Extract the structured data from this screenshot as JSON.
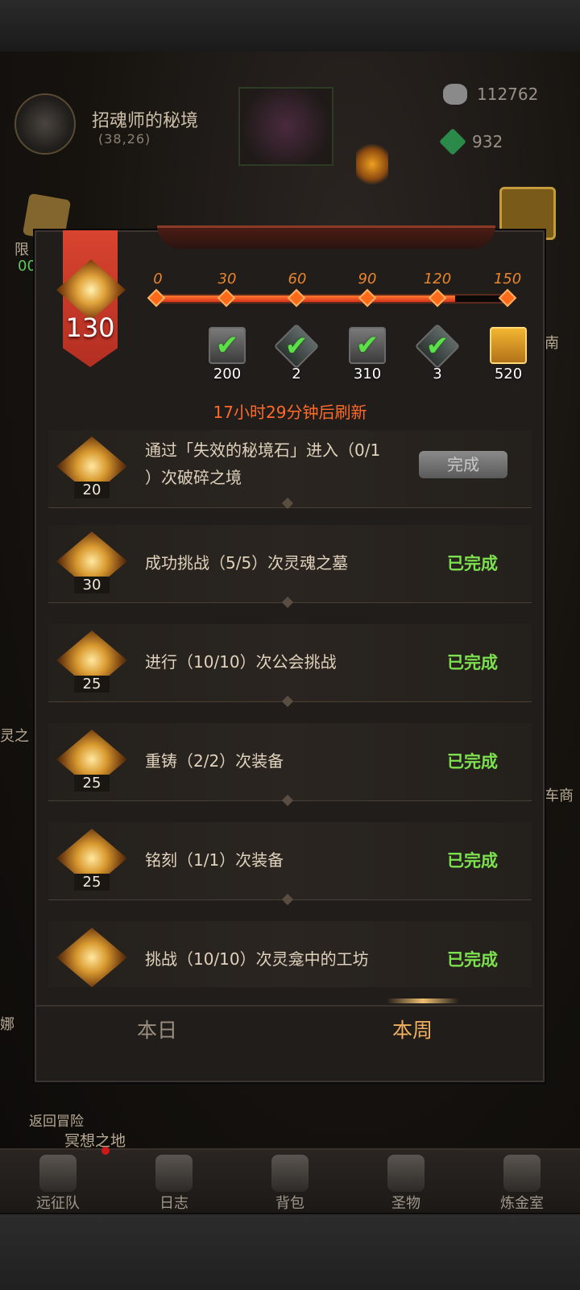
{
  "location": {
    "name": "招魂师的秘境",
    "coords": "(38,26)"
  },
  "resources": [
    {
      "icon": "stone-icon",
      "value": "112762"
    },
    {
      "icon": "green-gem-icon",
      "value": "932"
    }
  ],
  "side_labels": {
    "limited": "限",
    "limited_timer": "00",
    "south": "南",
    "spirit": "灵之",
    "caravan": "车商",
    "na": "娜",
    "return": "返回冒险",
    "meditation": "冥想之地"
  },
  "progress": {
    "points": "130",
    "fill_fraction": 0.85,
    "milestones": [
      "0",
      "30",
      "60",
      "90",
      "120",
      "150"
    ],
    "rewards": [
      {
        "icon": "scroll-icon",
        "count": "200",
        "claimed": true
      },
      {
        "icon": "green-gem-icon",
        "count": "2",
        "claimed": true
      },
      {
        "icon": "scroll-icon",
        "count": "310",
        "claimed": true
      },
      {
        "icon": "green-gem-icon",
        "count": "3",
        "claimed": true
      },
      {
        "icon": "gold-scroll-icon",
        "count": "520",
        "claimed": false
      }
    ],
    "refresh_text": "17小时29分钟后刷新"
  },
  "tasks": [
    {
      "points": "20",
      "line1": "通过「失效的秘境石」进入（0/1",
      "line2": "）次破碎之境",
      "action": "完成"
    },
    {
      "points": "30",
      "line1": "成功挑战（5/5）次灵魂之墓",
      "status": "已完成"
    },
    {
      "points": "25",
      "line1": "进行（10/10）次公会挑战",
      "status": "已完成"
    },
    {
      "points": "25",
      "line1": "重铸（2/2）次装备",
      "status": "已完成"
    },
    {
      "points": "25",
      "line1": "铭刻（1/1）次装备",
      "status": "已完成"
    },
    {
      "points": "",
      "line1": "挑战（10/10）次灵龛中的工坊",
      "status": "已完成"
    }
  ],
  "tabs": {
    "daily": "本日",
    "weekly": "本周"
  },
  "bottom_nav": [
    "远征队",
    "日志",
    "背包",
    "圣物",
    "炼金室"
  ]
}
